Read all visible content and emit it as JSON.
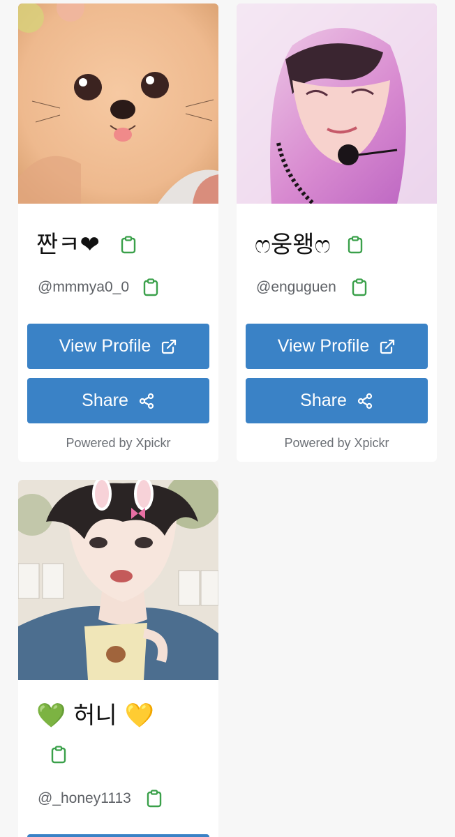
{
  "cards": [
    {
      "display_name": "짠ㅋ❤",
      "handle": "@mmmya0_0",
      "view_label": "View Profile",
      "share_label": "Share",
      "powered": "Powered by Xpickr"
    },
    {
      "display_name": "ෆ웅왱ෆ",
      "handle": "@enguguen",
      "view_label": "View Profile",
      "share_label": "Share",
      "powered": "Powered by Xpickr"
    },
    {
      "display_name": "💚 허니 💛",
      "handle": "@_honey1113"
    }
  ],
  "colors": {
    "button": "#3a82c6",
    "clipboard_icon": "#3aa04a",
    "background": "#f7f7f7"
  },
  "icons": {
    "copy": "clipboard-icon",
    "external": "external-link-icon",
    "share": "share-icon"
  }
}
